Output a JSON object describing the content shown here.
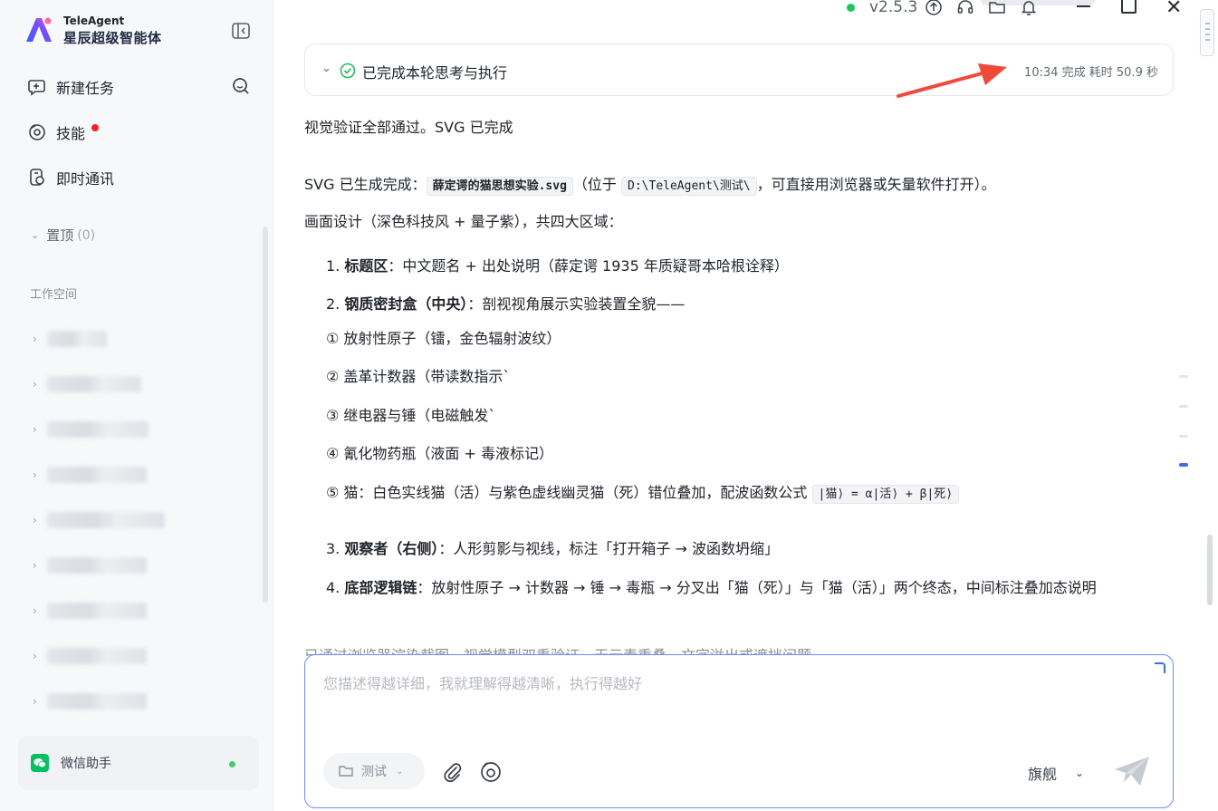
{
  "app": {
    "brand_en": "TeleAgent",
    "brand_cn": "星辰超级智能体",
    "version": "v2.5.3"
  },
  "sidebar": {
    "nav": [
      {
        "label": "新建任务",
        "icon": "new-task-icon"
      },
      {
        "label": "技能",
        "icon": "skills-icon",
        "badge": "red-dot"
      },
      {
        "label": "即时通讯",
        "icon": "messaging-icon"
      }
    ],
    "pinned": {
      "label": "置顶",
      "count": "(0)"
    },
    "workspace_label": "工作空间",
    "wechat": {
      "label": "微信助手",
      "status_color": "#3fcf6b"
    }
  },
  "conversation": {
    "done_panel": {
      "title": "已完成本轮思考与执行",
      "meta": "10:34 完成 耗时 50.9 秒"
    },
    "intro": "视觉验证全部通过。SVG 已完成",
    "svg_line": {
      "prefix": "SVG 已生成完成：",
      "filename": "薛定谔的猫思想实验.svg",
      "middle": "（位于",
      "path": "D:\\TeleAgent\\测试\\",
      "suffix": "，可直接用浏览器或矢量软件打开）。"
    },
    "design_line": "画面设计（深色科技风 + 量子紫），共四大区域：",
    "items": [
      {
        "num": "1.",
        "title": "标题区",
        "text": "：中文题名 + 出处说明（薛定谔 1935 年质疑哥本哈根诠释）"
      },
      {
        "num": "2.",
        "title": "钢质密封盒（中央）",
        "text": "：剖视视角展示实验装置全貌——"
      }
    ],
    "subitems": [
      "① 放射性原子（镭，金色辐射波纹）",
      "② 盖革计数器（带读数指示`",
      "③ 继电器与锤（电磁触发`",
      "④ 氰化物药瓶（液面 + 毒液标记）"
    ],
    "cat_item": {
      "text": "⑤ 猫：白色实线猫（活）与紫色虚线幽灵猫（死）错位叠加，配波函数公式",
      "formula": "|猫⟩ = α|活⟩ + β|死⟩"
    },
    "items2": [
      {
        "num": "3.",
        "title": "观察者（右侧）",
        "text": "：人形剪影与视线，标注「打开箱子 → 波函数坍缩」"
      },
      {
        "num": "4.",
        "title": "底部逻辑链",
        "text": "：放射性原子 → 计数器 → 锤 → 毒瓶 → 分叉出「猫（死）」与「猫（活）」两个终态，中间标注叠加态说明"
      }
    ],
    "cutoff_line": "已通过浏览器渲染截图，视觉模型双重验证，无元素重叠，文字溢出或遮挡问题。"
  },
  "composer": {
    "placeholder": "您描述得越详细，我就理解得越清晰，执行得越好",
    "folder": "测试",
    "model": "旗舰"
  },
  "colors": {
    "accent": "#3d6bf2",
    "success": "#1fc55b",
    "arrow": "#f04a3a"
  }
}
